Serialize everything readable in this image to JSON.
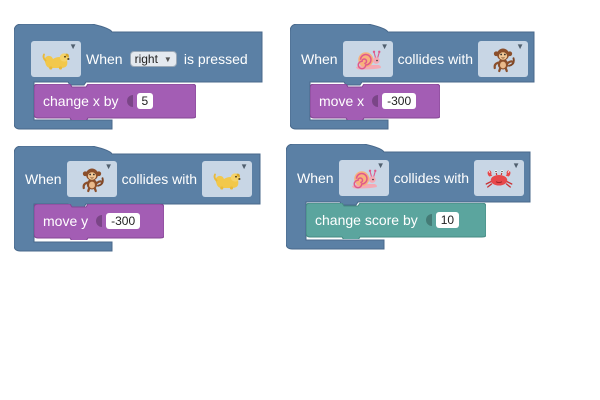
{
  "colors": {
    "event": "#5b80a5",
    "event_dark": "#48688b",
    "sprite_action": "#a35db4",
    "sprite_action_dark": "#844693",
    "score_action": "#5ba59e",
    "score_action_dark": "#468a83",
    "dropdown": "#c8d6e5"
  },
  "blocks": [
    {
      "hat": {
        "sprite": "dog-icon",
        "when": "When",
        "key": "right",
        "suffix": "is pressed"
      },
      "action": {
        "label": "change x by",
        "value": "5"
      }
    },
    {
      "hat": {
        "when": "When",
        "sprite_a": "snail-icon",
        "middle": "collides with",
        "sprite_b": "monkey-icon"
      },
      "action": {
        "label": "move x",
        "value": "-300"
      }
    },
    {
      "hat": {
        "when": "When",
        "sprite_a": "monkey-icon",
        "middle": "collides with",
        "sprite_b": "dog-icon"
      },
      "action": {
        "label": "move y",
        "value": "-300"
      }
    },
    {
      "hat": {
        "when": "When",
        "sprite_a": "snail-icon",
        "middle": "collides with",
        "sprite_b": "crab-icon"
      },
      "action": {
        "label": "change score by",
        "value": "10"
      }
    }
  ]
}
